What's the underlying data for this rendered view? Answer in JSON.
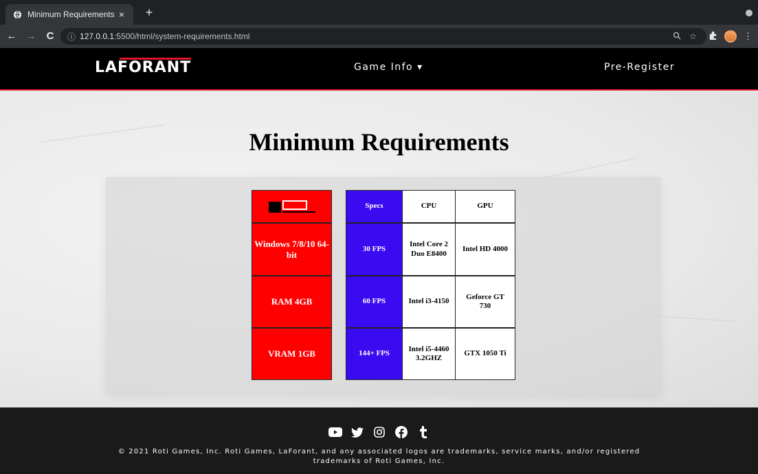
{
  "browser": {
    "tab_title": "Minimum Requirements",
    "tab_close": "×",
    "new_tab": "+",
    "url_info": "ⓘ",
    "url_host": "127.0.0.1",
    "url_rest": ":5500/html/system-requirements.html",
    "back": "←",
    "forward": "→",
    "reload": "C"
  },
  "nav": {
    "logo": "LAFORANT",
    "game_info": "Game Info ▾",
    "pre_register": "Pre-Register"
  },
  "page": {
    "heading": "Minimum Requirements"
  },
  "requirements": {
    "left_column": [
      {
        "label": ""
      },
      {
        "label": "Windows 7/8/10 64-bit"
      },
      {
        "label": "RAM 4GB"
      },
      {
        "label": "VRAM 1GB"
      }
    ],
    "specs_header": "Specs",
    "cpu_header": "CPU",
    "gpu_header": "GPU",
    "rows": [
      {
        "spec": "30 FPS",
        "cpu": "Intel Core 2 Duo E8400",
        "gpu": "Intel HD 4000"
      },
      {
        "spec": "60 FPS",
        "cpu": "Intel i3-4150",
        "gpu": "Geforce GT 730"
      },
      {
        "spec": "144+ FPS",
        "cpu": "Intel i5-4460 3.2GHZ",
        "gpu": "GTX 1050 Ti"
      }
    ]
  },
  "footer": {
    "icons": [
      "youtube-icon",
      "twitter-icon",
      "instagram-icon",
      "facebook-icon",
      "tumblr-icon"
    ],
    "copyright": "© 2021 Roti Games, Inc. Roti Games, LaForant, and any associated logos are trademarks, service marks, and/or registered trademarks of Roti Games, Inc."
  },
  "colors": {
    "accent_red": "#ff0000",
    "accent_blue": "#3a0af0",
    "nav_border": "#e0142f"
  }
}
